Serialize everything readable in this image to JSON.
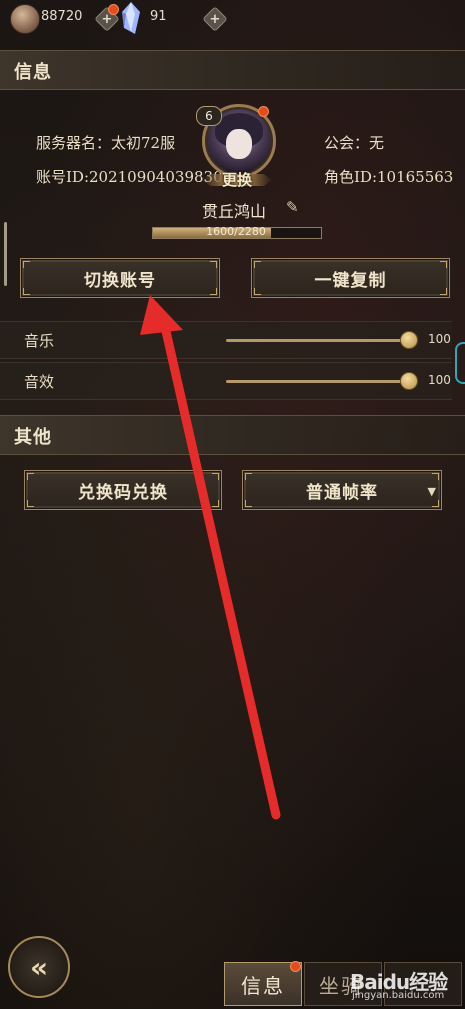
{
  "top_bar": {
    "coin_value": "88720",
    "gem_value": "91",
    "plus_label": "+"
  },
  "info": {
    "section_title": "信息",
    "server_label": "服务器名：太初72服",
    "guild_label": "公会：无",
    "account_id_label": "账号ID:20210904039830",
    "role_id_label": "角色ID:10165563",
    "level": "6",
    "change_label": "更换",
    "nickname": "贯丘鸿山",
    "exp_text": "1600/2280",
    "exp_fraction": 0.7018,
    "switch_account_label": "切换账号",
    "copy_label": "一键复制"
  },
  "audio": {
    "music_label": "音乐",
    "music_value": "100",
    "sfx_label": "音效",
    "sfx_value": "100"
  },
  "other": {
    "section_title": "其他",
    "redeem_label": "兑换码兑换",
    "frame_rate_label": "普通帧率",
    "dropdown_arrow": "▼"
  },
  "bottom": {
    "back_glyph": "«",
    "tab_info": "信息",
    "tab_other_partial": "坐骑"
  },
  "watermark": {
    "logo": "Baidu经验",
    "url": "jingyan.baidu.com"
  },
  "colors": {
    "accent_gold": "#b59a68",
    "annotation_arrow": "#e62b2b",
    "notification_dot": "#e44c1e"
  }
}
